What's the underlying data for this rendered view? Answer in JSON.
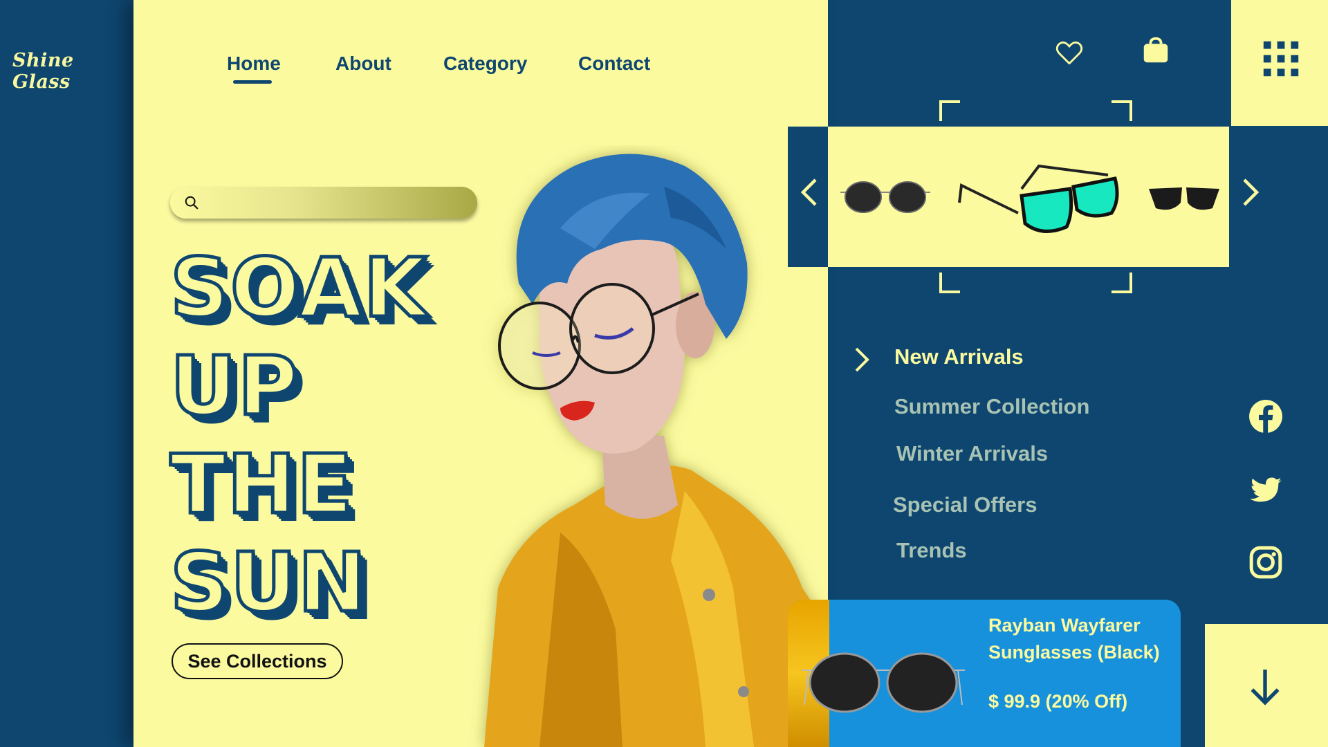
{
  "brand": {
    "logo_text": "Shine Glass"
  },
  "nav": {
    "items": [
      {
        "label": "Home",
        "active": true
      },
      {
        "label": "About"
      },
      {
        "label": "Category"
      },
      {
        "label": "Contact"
      }
    ]
  },
  "search": {
    "placeholder": ""
  },
  "hero": {
    "headline_lines": [
      "SOAK",
      "UP",
      "THE",
      "SUN"
    ],
    "cta_label": "See Collections"
  },
  "header_icons": [
    "heart-icon",
    "shopping-bag-icon",
    "grid-menu-icon"
  ],
  "carousel": {
    "prev_icon": "chevron-left-icon",
    "next_icon": "chevron-right-icon",
    "items": [
      "round-dark-sunglasses",
      "teal-square-sunglasses",
      "black-wayfarer-sunglasses"
    ]
  },
  "menu": {
    "items": [
      {
        "label": "New Arrivals",
        "active": true
      },
      {
        "label": "Summer Collection"
      },
      {
        "label": "Winter Arrivals"
      },
      {
        "label": "Special Offers"
      },
      {
        "label": "Trends"
      }
    ]
  },
  "social": [
    "facebook-icon",
    "twitter-icon",
    "instagram-icon"
  ],
  "product": {
    "title": "Rayban Wayfarer Sunglasses (Black)",
    "price": "$ 99.9 (20% Off)"
  },
  "colors": {
    "navy": "#0e4670",
    "pale_yellow": "#fbfa9f",
    "card_blue": "#1891dc",
    "muted_menu": "#a8c3b3"
  }
}
